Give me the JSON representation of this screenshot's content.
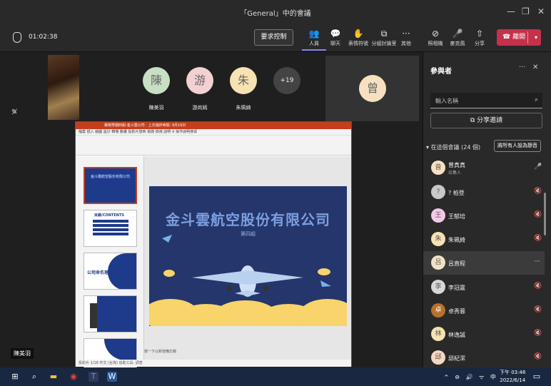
{
  "window": {
    "title": "「General」中的會議",
    "controls": [
      "—",
      "❐",
      "✕"
    ]
  },
  "toolbar": {
    "timer": "01:02:38",
    "request_control": "要求控制",
    "buttons": [
      {
        "icon": "people-icon",
        "glyph": "👥",
        "label": "人員",
        "active": true
      },
      {
        "icon": "chat-icon",
        "glyph": "💬",
        "label": "聊天"
      },
      {
        "icon": "reactions-icon",
        "glyph": "✋",
        "label": "表情符號"
      },
      {
        "icon": "breakout-rooms-icon",
        "glyph": "⧉",
        "label": "分組討論室"
      },
      {
        "icon": "more-icon",
        "glyph": "···",
        "label": "其他"
      },
      {
        "icon": "camera-off-icon",
        "glyph": "⊘",
        "label": "照相機"
      },
      {
        "icon": "microphone-icon",
        "glyph": "🎤",
        "label": "麥克風"
      },
      {
        "icon": "share-icon",
        "glyph": "⇧",
        "label": "分享"
      }
    ],
    "leave": "離開",
    "leave_color": "#c4314b"
  },
  "stage": {
    "participants": [
      {
        "initial": "陳",
        "name": "陳美羽",
        "color": "#c9dfc4"
      },
      {
        "initial": "游",
        "name": "游尚嫣",
        "color": "#f3d0d2"
      },
      {
        "initial": "朱",
        "name": "朱珮綺",
        "color": "#f6e2b2"
      }
    ],
    "overflow": "+19",
    "right_tile": {
      "initial": "曾",
      "color": "#f6e0c0"
    },
    "presenter_name": "陳美羽"
  },
  "ppt": {
    "title_bar": "專題學期四組-金斗雲公司 · 上次儲存時間: 9月16日",
    "tabs": "檔案  插入  繪圖  設計  轉場  動畫  投影片放映  檢閱  檢視  說明  ♀ 操作說明搜尋",
    "slide_title": "金斗雲航空股份有限公司",
    "slide_subtitle": "第四組",
    "notes": "按一下以新增備忘稿",
    "status": "投影片 1/18   中文 (台灣)   協助工具: 調查",
    "thumbs": [
      {
        "num": "1",
        "text": "金斗雲航空股份有限公司"
      },
      {
        "num": "2",
        "text": "目錄/CONTENTS"
      },
      {
        "num": "3",
        "text": "公司命名理由"
      },
      {
        "num": "4",
        "text": ""
      },
      {
        "num": "5",
        "text": ""
      }
    ]
  },
  "panel": {
    "title": "參與者",
    "search_placeholder": "輸入名稱",
    "invite": "分享邀請",
    "section": "在這個會議 (24 個)",
    "mute_all": "將所有人設為靜音",
    "people": [
      {
        "initial": "曾",
        "name": "曾真真",
        "role": "召集人",
        "color": "#f6e0c0",
        "mic": "🎤"
      },
      {
        "initial": "?",
        "name": "? 柏登",
        "role": "",
        "color": "#c8c8c8",
        "mic": "🔇"
      },
      {
        "initial": "王",
        "name": "王郁培",
        "role": "",
        "color": "#f4c9e6",
        "mic": "🔇"
      },
      {
        "initial": "朱",
        "name": "朱珮綺",
        "role": "",
        "color": "#f6e2b2",
        "mic": "🔇"
      },
      {
        "initial": "呂",
        "name": "呂直程",
        "role": "",
        "color": "#f2e1c3",
        "mic": "···"
      },
      {
        "initial": "李",
        "name": "李冠霆",
        "role": "",
        "color": "#d7d7d7",
        "mic": "🔇"
      },
      {
        "initial": "卓",
        "name": "卓秀蓉",
        "role": "",
        "color": "#b8702a",
        "mic": "🔇"
      },
      {
        "initial": "林",
        "name": "林逸誠",
        "role": "",
        "color": "#f6e2b2",
        "mic": "🔇"
      },
      {
        "initial": "邱",
        "name": "邱紀潔",
        "role": "",
        "color": "#f4d8c0",
        "mic": "🔇"
      }
    ]
  },
  "taskbar": {
    "time": "下午 03:46",
    "date": "2022/6/14",
    "tray": "^ ⊖ 🔊 ᯤ 中"
  }
}
